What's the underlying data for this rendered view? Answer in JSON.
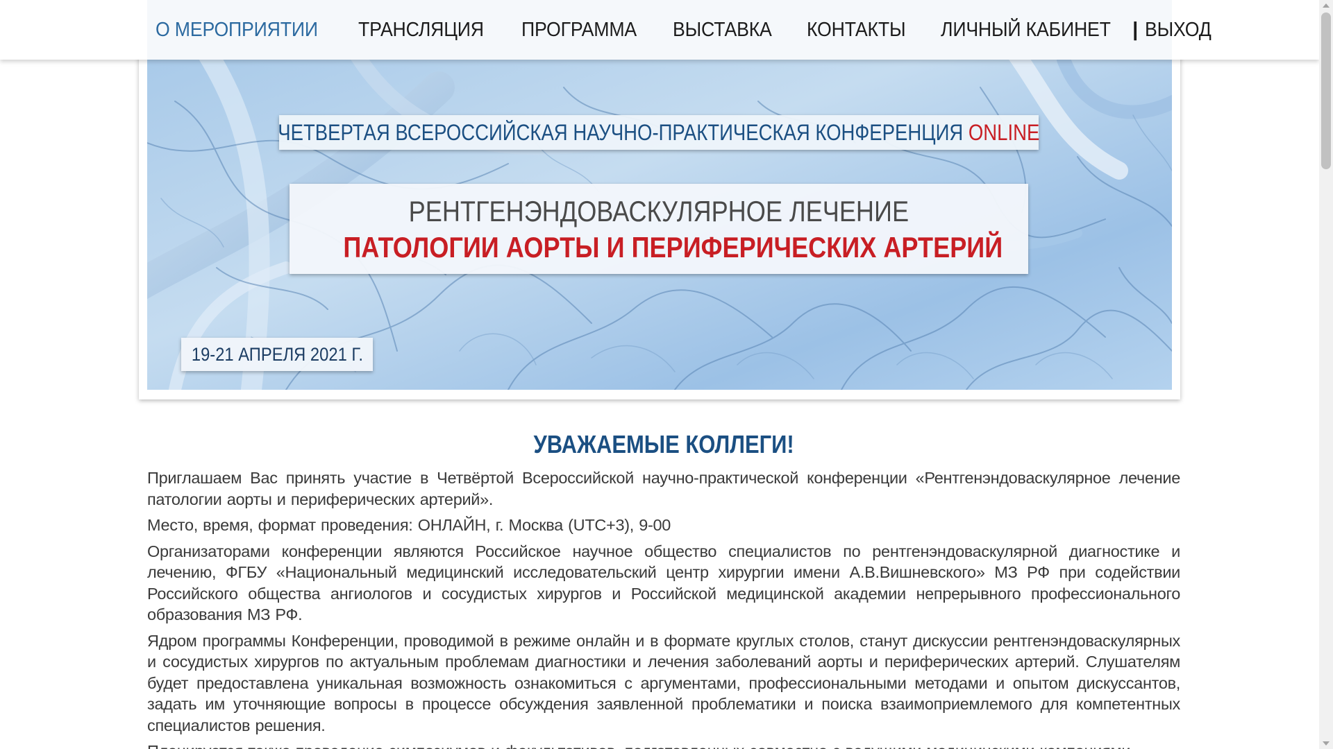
{
  "nav": {
    "items": [
      {
        "label": "О МЕРОПРИЯТИИ",
        "active": true
      },
      {
        "label": "ТРАНСЛЯЦИЯ",
        "active": false
      },
      {
        "label": "ПРОГРАММА",
        "active": false
      },
      {
        "label": "ВЫСТАВКА",
        "active": false
      },
      {
        "label": "КОНТАКТЫ",
        "active": false
      }
    ],
    "account": "ЛИЧНЫЙ КАБИНЕТ",
    "separator": "|",
    "logout": "ВЫХОД"
  },
  "banner": {
    "subtitle": "ЧЕТВЕРТАЯ ВСЕРОССИЙСКАЯ НАУЧНО-ПРАКТИЧЕСКАЯ КОНФЕРЕНЦИЯ",
    "subtitle_accent": "ONLINE",
    "title_line1": "РЕНТГЕНЭНДОВАСКУЛЯРНОЕ ЛЕЧЕНИЕ",
    "title_line2": "ПАТОЛОГИИ АОРТЫ И ПЕРИФЕРИЧЕСКИХ АРТЕРИЙ",
    "date": "19-21 АПРЕЛЯ 2021 Г."
  },
  "content": {
    "greeting": "УВАЖАЕМЫЕ КОЛЛЕГИ!",
    "paragraphs": [
      "Приглашаем Вас принять участие в Четвёртой Всероссийской научно-практической конференции «Рентгенэндоваскулярное лечение патологии аорты и периферических артерий».",
      "Место, время, формат проведения: ОНЛАЙН, г. Москва (UTC+3), 9-00",
      "Организаторами конференции являются Российское научное общество специалистов по рентгенэндоваскулярной диагностике и лечению, ФГБУ «Национальный медицинский исследовательский центр хирургии имени А.В.Вишневского» МЗ РФ при содействии Российского общества ангиологов и сосудистых хирургов и Российской медицинской академии непрерывного профессионального образования МЗ РФ.",
      "Ядром программы Конференции, проводимой в режиме онлайн и в формате круглых столов, станут дискуссии рентгенэндоваскулярных и сосудистых хирургов по актуальным проблемам диагностики и лечения заболеваний аорты и периферических артерий. Слушателям будет предоставлена уникальная возможность ознакомиться с аргументами, профессиональными методами и опытом дискуссантов, задать им уточняющие вопросы в процессе обсуждения заявленной проблематики и поиска взаимоприемлемого для компетентных специалистов решения.",
      "Планируется также проведение симпозиумов и факультативов, подготовленных совместно с ведущими медицинскими компаниями."
    ]
  },
  "colors": {
    "accent_blue": "#1b4f82",
    "nav_active": "#2c6aa0",
    "accent_red": "#c81e24",
    "text": "#3a3a3a"
  }
}
